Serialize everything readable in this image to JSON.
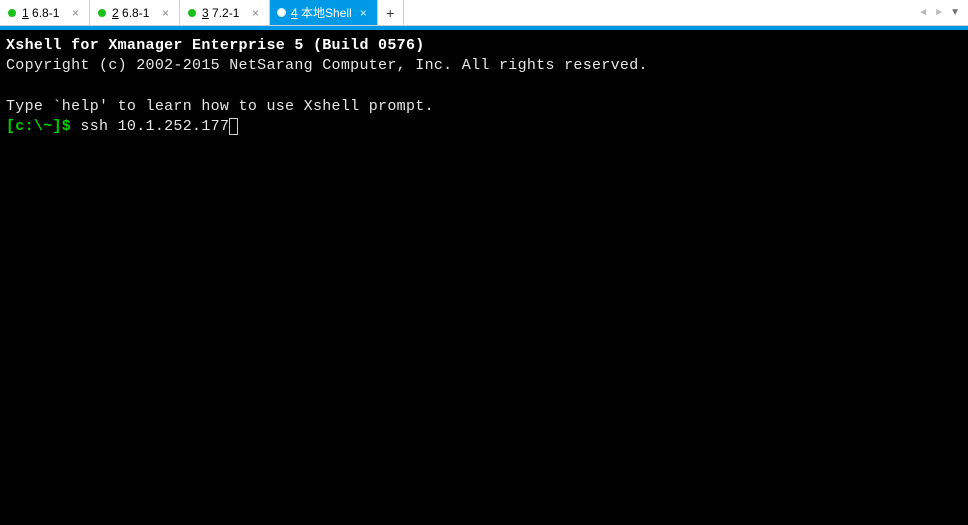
{
  "tabs": [
    {
      "num": "1",
      "label": "6.8-1",
      "status": "green",
      "active": false
    },
    {
      "num": "2",
      "label": "6.8-1",
      "status": "green",
      "active": false
    },
    {
      "num": "3",
      "label": "7.2-1",
      "status": "green",
      "active": false
    },
    {
      "num": "4",
      "label": "本地Shell",
      "status": "white",
      "active": true
    }
  ],
  "newtab_glyph": "+",
  "nav": {
    "left": "◄",
    "right": "►",
    "menu": "▼"
  },
  "terminal": {
    "title_line": "Xshell for Xmanager Enterprise 5 (Build 0576)",
    "copyright_line": "Copyright (c) 2002-2015 NetSarang Computer, Inc. All rights reserved.",
    "help_line": "Type `help' to learn how to use Xshell prompt.",
    "prompt": "[c:\\~]$ ",
    "command": "ssh 10.1.252.177"
  }
}
